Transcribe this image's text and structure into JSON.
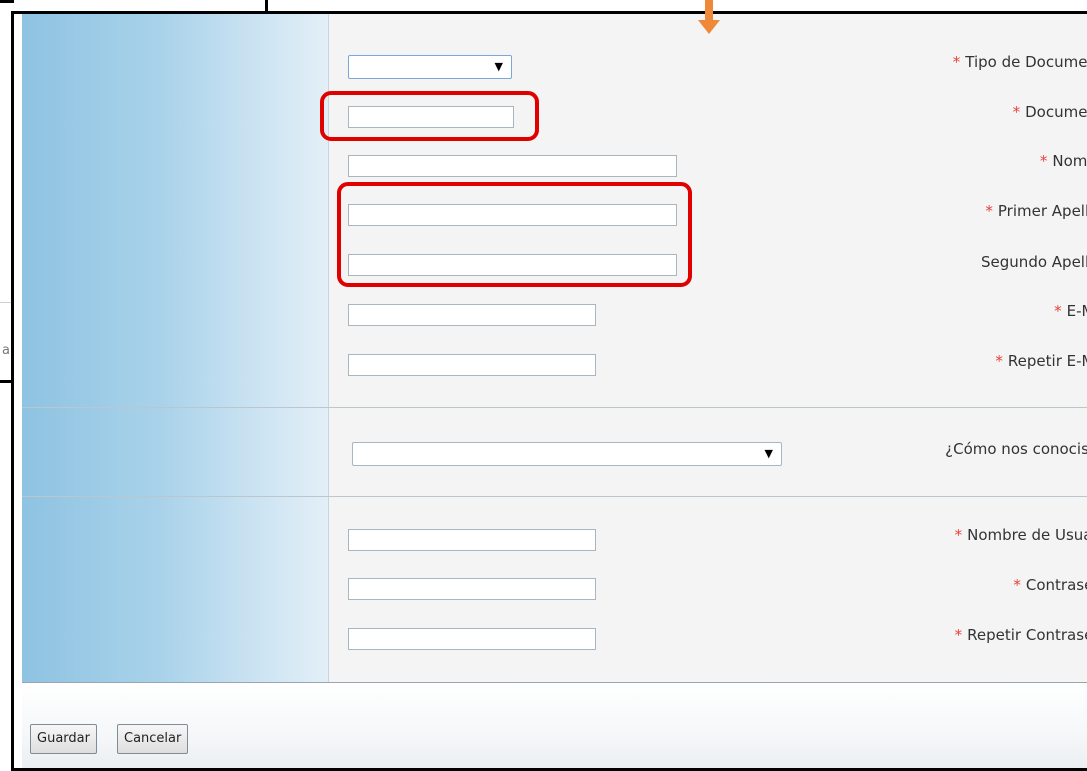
{
  "background_window": {
    "partial_text": "a"
  },
  "form": {
    "required_mark": "*",
    "tipo_documento": {
      "label": "Tipo de Documento",
      "value": ""
    },
    "documento": {
      "label": "Documento",
      "value": ""
    },
    "nombre": {
      "label": "Nombre",
      "value": ""
    },
    "primer_apellido": {
      "label": "Primer Apellido",
      "value": ""
    },
    "segundo_apellido": {
      "label": "Segundo Apellido",
      "value": ""
    },
    "email": {
      "label": "E-Mail",
      "value": ""
    },
    "repetir_email": {
      "label": "Repetir E-Mail",
      "value": ""
    },
    "como_nos_conociste": {
      "label": "¿Cómo nos conociste?",
      "value": ""
    },
    "nombre_usuario": {
      "label": "Nombre de Usuario",
      "value": ""
    },
    "contrasena": {
      "label": "Contraseña",
      "value": ""
    },
    "repetir_contrasena": {
      "label": "Repetir Contraseña",
      "value": ""
    }
  },
  "buttons": {
    "save": "Guardar",
    "cancel": "Cancelar"
  },
  "icons": {
    "dropdown": "chevron-down-icon",
    "pointer": "down-arrow-icon"
  },
  "colors": {
    "highlight": "#e00000",
    "required": "#e8403a",
    "arrow": "#f0883a",
    "label_column": "#a9d2ea"
  }
}
